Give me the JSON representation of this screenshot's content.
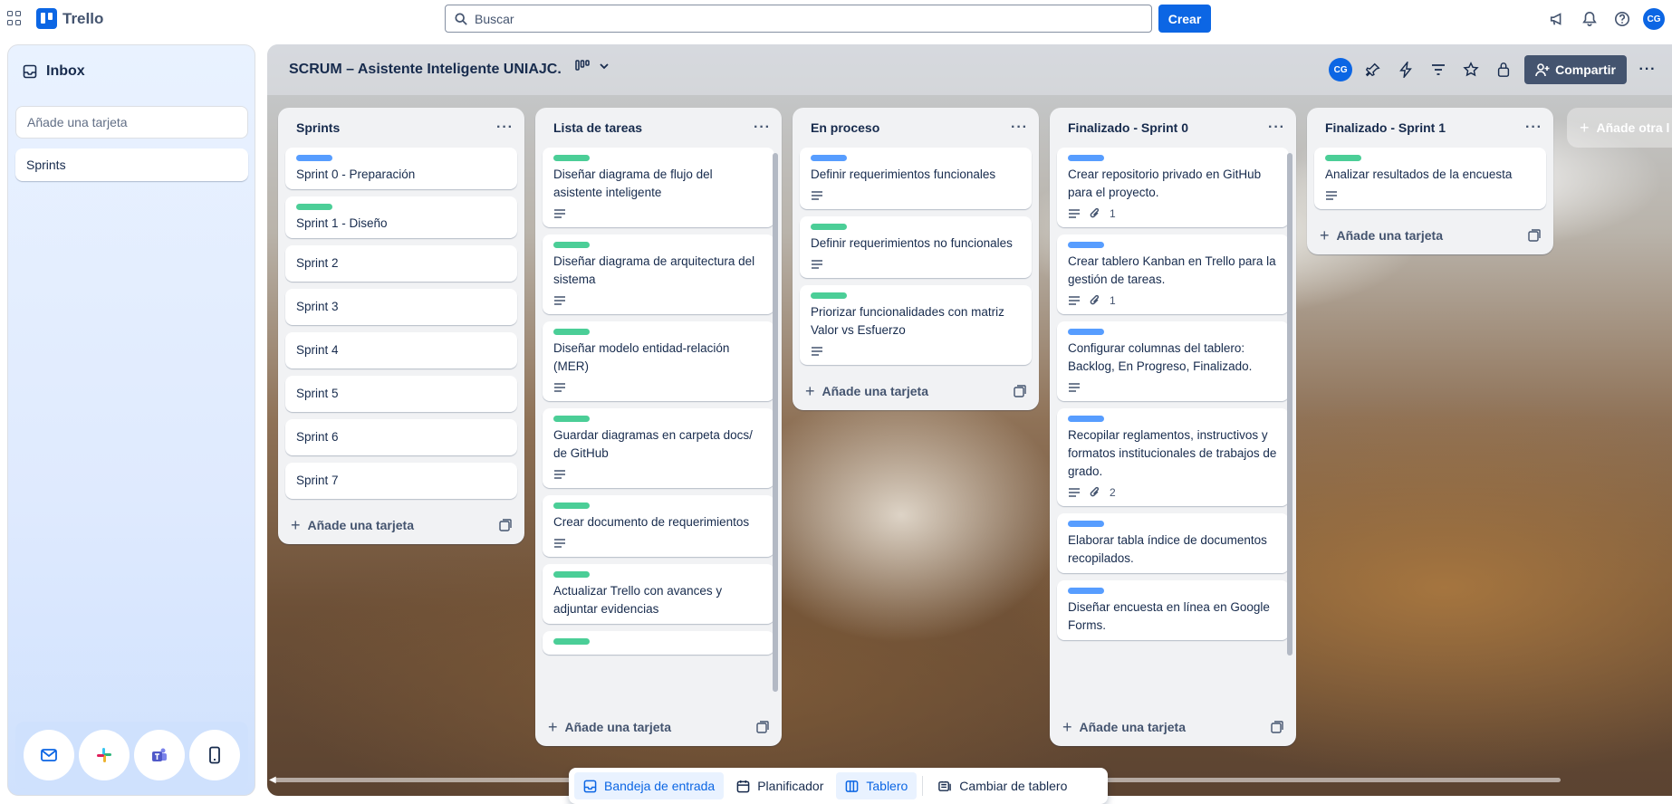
{
  "app": {
    "name": "Trello"
  },
  "search": {
    "placeholder": "Buscar"
  },
  "create_label": "Crear",
  "user_initials": "CG",
  "inbox": {
    "title": "Inbox",
    "add_placeholder": "Añade una tarjeta",
    "cards": [
      "Sprints"
    ]
  },
  "board": {
    "title": "SCRUM – Asistente Inteligente UNIAJC.",
    "share_label": "Compartir",
    "add_list_label": "Añade otra l",
    "lists": [
      {
        "name": "Sprints",
        "add_label": "Añade una tarjeta",
        "cards": [
          {
            "title": "Sprint 0 - Preparación",
            "label_color": "#579dff"
          },
          {
            "title": "Sprint 1 - Diseño",
            "label_color": "#4bce97"
          },
          {
            "title": "Sprint 2"
          },
          {
            "title": "Sprint 3"
          },
          {
            "title": "Sprint 4"
          },
          {
            "title": "Sprint 5"
          },
          {
            "title": "Sprint 6"
          },
          {
            "title": "Sprint 7"
          }
        ]
      },
      {
        "name": "Lista de tareas",
        "add_label": "Añade una tarjeta",
        "cards": [
          {
            "title": "Diseñar diagrama de flujo del asistente inteligente",
            "label_color": "#4bce97",
            "description": true
          },
          {
            "title": "Diseñar diagrama de arquitectura del sistema",
            "label_color": "#4bce97",
            "description": true
          },
          {
            "title": "Diseñar modelo entidad-relación (MER)",
            "label_color": "#4bce97",
            "description": true
          },
          {
            "title": "Guardar diagramas en carpeta docs/ de GitHub",
            "label_color": "#4bce97",
            "description": true
          },
          {
            "title": "Crear documento de requerimientos",
            "label_color": "#4bce97",
            "description": true
          },
          {
            "title": "Actualizar Trello con avances y adjuntar evidencias",
            "label_color": "#4bce97"
          },
          {
            "title": "",
            "label_color": "#4bce97"
          }
        ]
      },
      {
        "name": "En proceso",
        "add_label": "Añade una tarjeta",
        "cards": [
          {
            "title": "Definir requerimientos funcionales",
            "label_color": "#579dff",
            "description": true
          },
          {
            "title": "Definir requerimientos no funcionales",
            "label_color": "#4bce97",
            "description": true
          },
          {
            "title": "Priorizar funcionalidades con matriz Valor vs Esfuerzo",
            "label_color": "#4bce97",
            "description": true
          }
        ]
      },
      {
        "name": "Finalizado - Sprint 0",
        "add_label": "Añade una tarjeta",
        "cards": [
          {
            "title": "Crear repositorio privado en GitHub para el proyecto.",
            "label_color": "#579dff",
            "description": true,
            "attachments": "1"
          },
          {
            "title": "Crear tablero Kanban en Trello para la gestión de tareas.",
            "label_color": "#579dff",
            "description": true,
            "attachments": "1"
          },
          {
            "title": "Configurar columnas del tablero: Backlog, En Progreso, Finalizado.",
            "label_color": "#579dff",
            "description": true
          },
          {
            "title": "Recopilar reglamentos, instructivos y formatos institucionales de trabajos de grado.",
            "label_color": "#579dff",
            "description": true,
            "attachments": "2"
          },
          {
            "title": "Elaborar tabla índice de documentos recopilados.",
            "label_color": "#579dff"
          },
          {
            "title": "Diseñar encuesta en línea en Google Forms.",
            "label_color": "#579dff"
          }
        ]
      },
      {
        "name": "Finalizado - Sprint 1",
        "add_label": "Añade una tarjeta",
        "cards": [
          {
            "title": "Analizar resultados de la encuesta",
            "label_color": "#4bce97",
            "description": true
          }
        ]
      }
    ]
  },
  "switcher": {
    "inbox": "Bandeja de entrada",
    "planner": "Planificador",
    "board": "Tablero",
    "switch": "Cambiar de tablero"
  }
}
